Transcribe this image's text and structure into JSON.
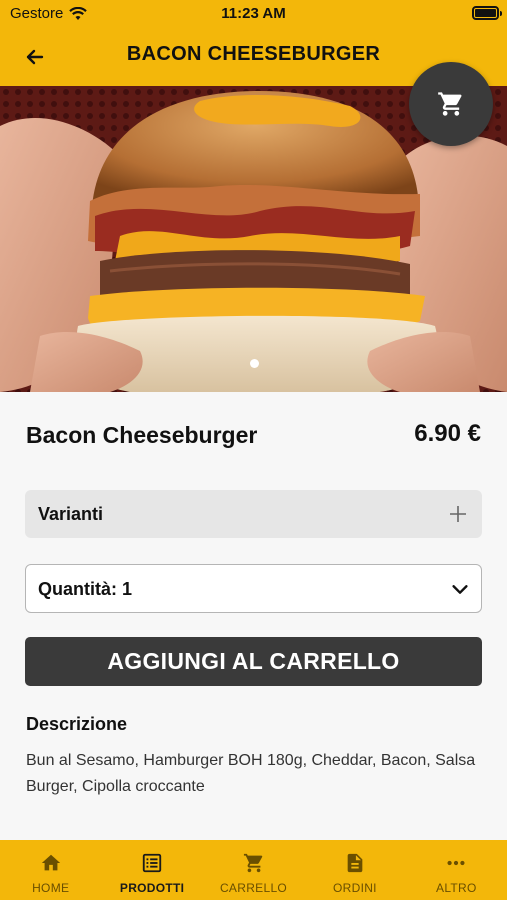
{
  "status_bar": {
    "carrier": "Gestore",
    "time": "11:23 AM"
  },
  "header": {
    "title": "BACON CHEESEBURGER"
  },
  "product": {
    "name": "Bacon Cheeseburger",
    "price": "6.90 €"
  },
  "variants": {
    "label": "Varianti"
  },
  "quantity": {
    "label": "Quantità: 1"
  },
  "actions": {
    "add_to_cart": "AGGIUNGI AL CARRELLO"
  },
  "description": {
    "title": "Descrizione",
    "text": "Bun al Sesamo, Hamburger BOH 180g, Cheddar, Bacon, Salsa Burger, Cipolla croccante"
  },
  "tabs": [
    {
      "label": "HOME",
      "icon": "home-icon"
    },
    {
      "label": "PRODOTTI",
      "icon": "list-icon",
      "active": true
    },
    {
      "label": "CARRELLO",
      "icon": "cart-icon"
    },
    {
      "label": "ORDINI",
      "icon": "document-icon"
    },
    {
      "label": "ALTRO",
      "icon": "more-icon"
    }
  ],
  "colors": {
    "accent": "#f3b70a",
    "dark": "#3a3a3a"
  },
  "carousel": {
    "pages": 1,
    "current": 1
  }
}
